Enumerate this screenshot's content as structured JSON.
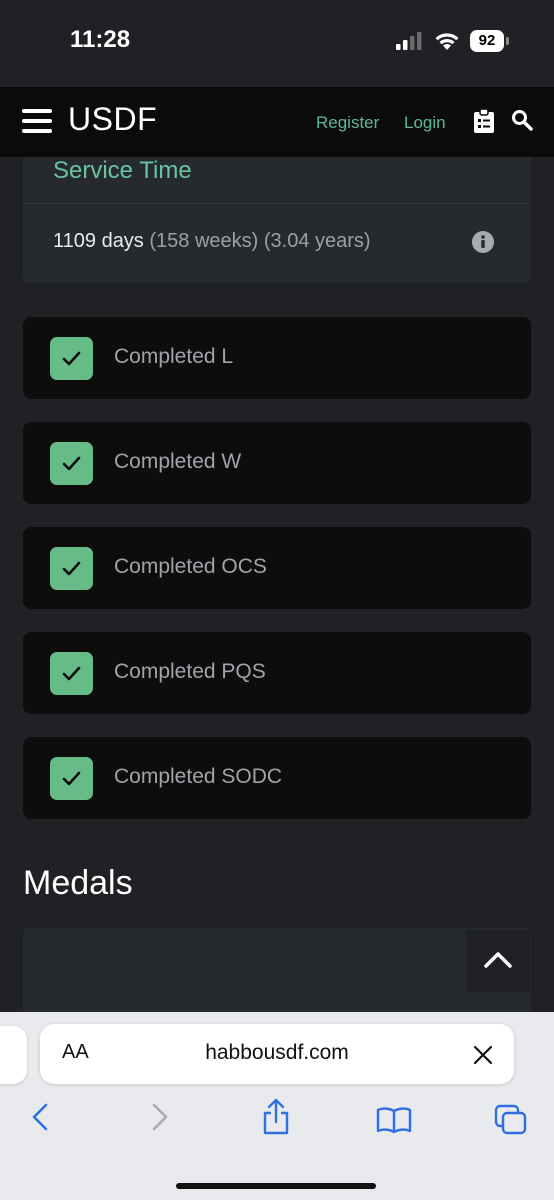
{
  "status_bar": {
    "time": "11:28",
    "battery": "92"
  },
  "navbar": {
    "brand": "USDF",
    "register": "Register",
    "login": "Login"
  },
  "service": {
    "title": "Service Time",
    "days": "1109 days",
    "detail": "(158 weeks) (3.04 years)"
  },
  "checklist": [
    {
      "label": "Completed L",
      "checked": true
    },
    {
      "label": "Completed W",
      "checked": true
    },
    {
      "label": "Completed OCS",
      "checked": true
    },
    {
      "label": "Completed PQS",
      "checked": true
    },
    {
      "label": "Completed SODC",
      "checked": true
    }
  ],
  "medals": {
    "heading": "Medals"
  },
  "browser": {
    "text_size_label": "AA",
    "url": "habbousdf.com"
  },
  "colors": {
    "accent": "#5fb899",
    "checkbox": "#66bb86",
    "page_bg": "#1f2125",
    "card_bg": "#0d0d0e"
  }
}
